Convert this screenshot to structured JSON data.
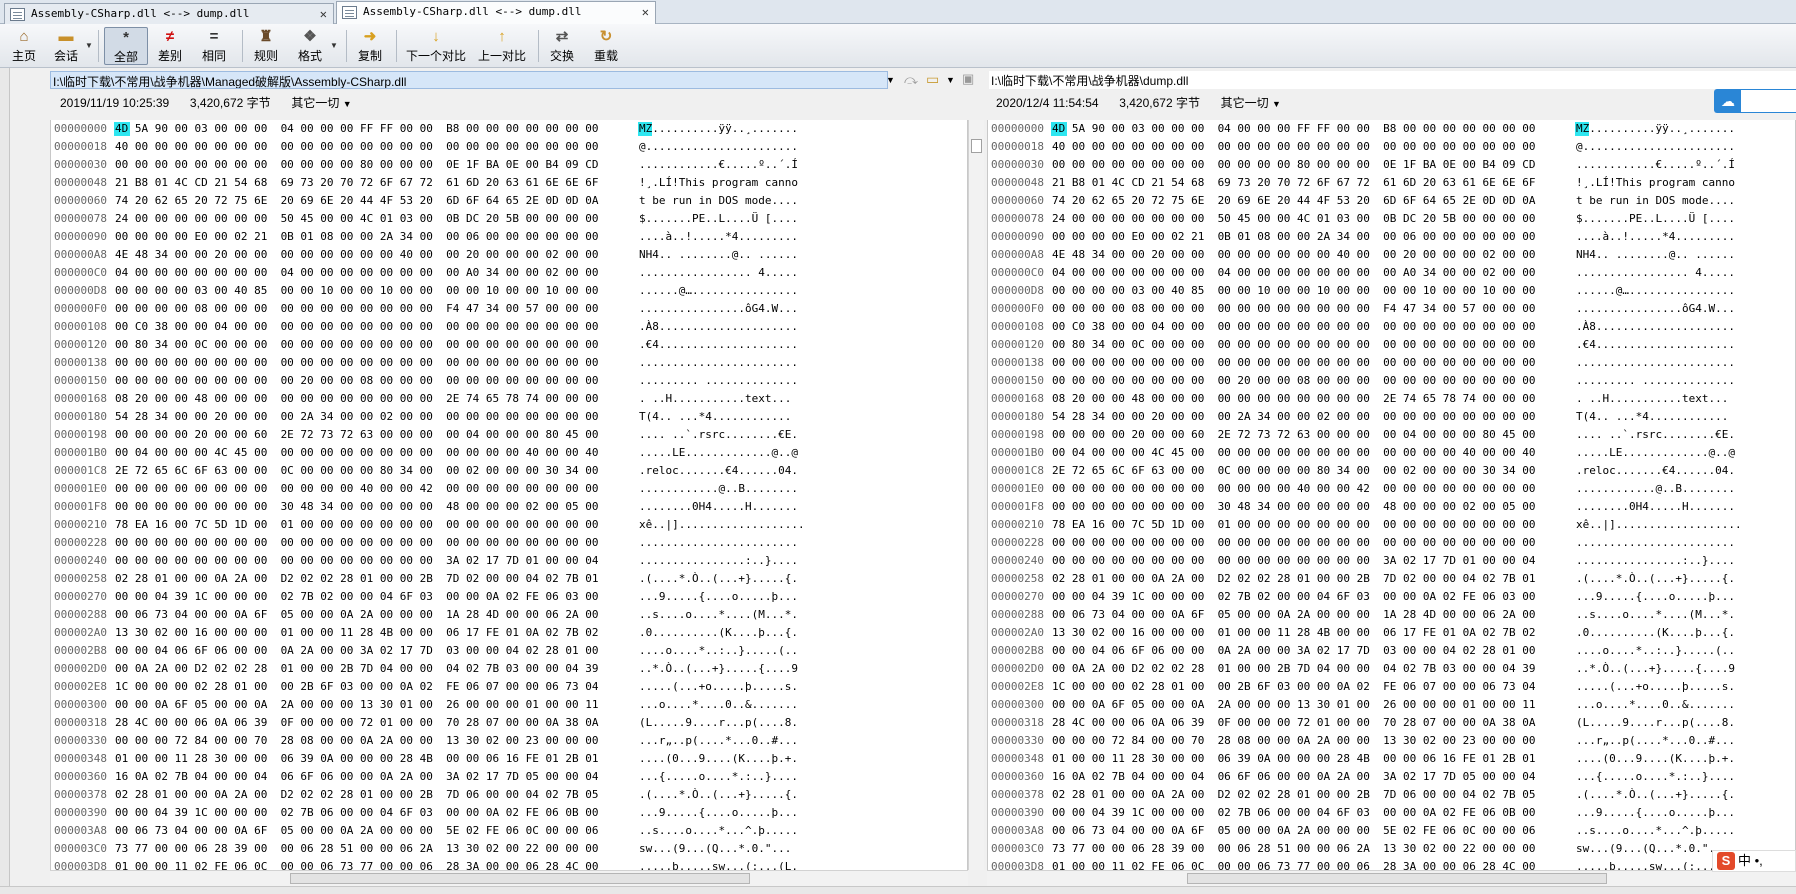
{
  "tabs": [
    {
      "label": "Assembly-CSharp.dll <--> dump.dll",
      "active": false
    },
    {
      "label": "Assembly-CSharp.dll <--> dump.dll",
      "active": true
    }
  ],
  "toolbar": {
    "home": "主页",
    "session": "会话",
    "all": "全部",
    "diffs": "差别",
    "same": "相同",
    "rules": "规则",
    "format": "格式",
    "copy": "复制",
    "next": "下一个对比",
    "prev": "上一对比",
    "swap": "交换",
    "reload": "重载"
  },
  "left": {
    "path": "I:\\临时下载\\不常用\\战争机器\\Managed破解版\\Assembly-CSharp.dll",
    "date": "2019/11/19 10:25:39",
    "size": "3,420,672 字节",
    "encoding": "其它一切"
  },
  "right": {
    "path": "I:\\临时下载\\不常用\\战争机器\\dump.dll",
    "date": "2020/12/4 11:54:54",
    "size": "3,420,672 字节",
    "encoding": "其它一切"
  },
  "rows": [
    {
      "addr": "00000000",
      "hex": "4D 5A 90 00 03 00 00 00  04 00 00 00 FF FF 00 00  B8 00 00 00 00 00 00 00",
      "ascii": "MZ..........ÿÿ..¸......."
    },
    {
      "addr": "00000018",
      "hex": "40 00 00 00 00 00 00 00  00 00 00 00 00 00 00 00  00 00 00 00 00 00 00 00",
      "ascii": "@......................."
    },
    {
      "addr": "00000030",
      "hex": "00 00 00 00 00 00 00 00  00 00 00 00 80 00 00 00  0E 1F BA 0E 00 B4 09 CD",
      "ascii": "............€.....º..´.Í"
    },
    {
      "addr": "00000048",
      "hex": "21 B8 01 4C CD 21 54 68  69 73 20 70 72 6F 67 72  61 6D 20 63 61 6E 6E 6F",
      "ascii": "!¸.LÍ!This program canno"
    },
    {
      "addr": "00000060",
      "hex": "74 20 62 65 20 72 75 6E  20 69 6E 20 44 4F 53 20  6D 6F 64 65 2E 0D 0D 0A",
      "ascii": "t be run in DOS mode...."
    },
    {
      "addr": "00000078",
      "hex": "24 00 00 00 00 00 00 00  50 45 00 00 4C 01 03 00  0B DC 20 5B 00 00 00 00",
      "ascii": "$.......PE..L....Ü [...."
    },
    {
      "addr": "00000090",
      "hex": "00 00 00 00 E0 00 02 21  0B 01 08 00 00 2A 34 00  00 06 00 00 00 00 00 00",
      "ascii": "....à..!.....*4........."
    },
    {
      "addr": "000000A8",
      "hex": "4E 48 34 00 00 20 00 00  00 00 00 00 00 00 40 00  00 20 00 00 00 02 00 00",
      "ascii": "NH4.. ........@.. ......"
    },
    {
      "addr": "000000C0",
      "hex": "04 00 00 00 00 00 00 00  04 00 00 00 00 00 00 00  00 A0 34 00 00 02 00 00",
      "ascii": "................. 4....."
    },
    {
      "addr": "000000D8",
      "hex": "00 00 00 00 03 00 40 85  00 00 10 00 00 10 00 00  00 00 10 00 00 10 00 00",
      "ascii": "......@…................"
    },
    {
      "addr": "000000F0",
      "hex": "00 00 00 00 08 00 00 00  00 00 00 00 00 00 00 00  F4 47 34 00 57 00 00 00",
      "ascii": "................ôG4.W..."
    },
    {
      "addr": "00000108",
      "hex": "00 C0 38 00 00 04 00 00  00 00 00 00 00 00 00 00  00 00 00 00 00 00 00 00",
      "ascii": ".À8....................."
    },
    {
      "addr": "00000120",
      "hex": "00 80 34 00 0C 00 00 00  00 00 00 00 00 00 00 00  00 00 00 00 00 00 00 00",
      "ascii": ".€4....................."
    },
    {
      "addr": "00000138",
      "hex": "00 00 00 00 00 00 00 00  00 00 00 00 00 00 00 00  00 00 00 00 00 00 00 00",
      "ascii": "........................"
    },
    {
      "addr": "00000150",
      "hex": "00 00 00 00 00 00 00 00  00 20 00 00 08 00 00 00  00 00 00 00 00 00 00 00",
      "ascii": "......... .............."
    },
    {
      "addr": "00000168",
      "hex": "08 20 00 00 48 00 00 00  00 00 00 00 00 00 00 00  2E 74 65 78 74 00 00 00",
      "ascii": ". ..H...........text..."
    },
    {
      "addr": "00000180",
      "hex": "54 28 34 00 00 20 00 00  00 2A 34 00 00 02 00 00  00 00 00 00 00 00 00 00",
      "ascii": "T(4.. ...*4............"
    },
    {
      "addr": "00000198",
      "hex": "00 00 00 00 20 00 00 60  2E 72 73 72 63 00 00 00  00 04 00 00 00 80 45 00",
      "ascii": ".... ..`.rsrc........€E."
    },
    {
      "addr": "000001B0",
      "hex": "00 04 00 00 00 4C 45 00  00 00 00 00 00 00 00 00  00 00 00 00 40 00 00 40",
      "ascii": ".....LE.............@..@"
    },
    {
      "addr": "000001C8",
      "hex": "2E 72 65 6C 6F 63 00 00  0C 00 00 00 00 80 34 00  00 02 00 00 00 30 34 00",
      "ascii": ".reloc.......€4......04."
    },
    {
      "addr": "000001E0",
      "hex": "00 00 00 00 00 00 00 00  00 00 00 00 40 00 00 42  00 00 00 00 00 00 00 00",
      "ascii": "............@..B........"
    },
    {
      "addr": "000001F8",
      "hex": "00 00 00 00 00 00 00 00  30 48 34 00 00 00 00 00  48 00 00 00 02 00 05 00",
      "ascii": "........0H4.....H......."
    },
    {
      "addr": "00000210",
      "hex": "78 EA 16 00 7C 5D 1D 00  01 00 00 00 00 00 00 00  00 00 00 00 00 00 00 00",
      "ascii": "xê..|]..................."
    },
    {
      "addr": "00000228",
      "hex": "00 00 00 00 00 00 00 00  00 00 00 00 00 00 00 00  00 00 00 00 00 00 00 00",
      "ascii": "........................"
    },
    {
      "addr": "00000240",
      "hex": "00 00 00 00 00 00 00 00  00 00 00 00 00 00 00 00  3A 02 17 7D 01 00 00 04",
      "ascii": "................:..}...."
    },
    {
      "addr": "00000258",
      "hex": "02 28 01 00 00 0A 2A 00  D2 02 02 28 01 00 00 2B  7D 02 00 00 04 02 7B 01",
      "ascii": ".(....*.Ò..(...+}.....{."
    },
    {
      "addr": "00000270",
      "hex": "00 00 04 39 1C 00 00 00  02 7B 02 00 00 04 6F 03  00 00 0A 02 FE 06 03 00",
      "ascii": "...9.....{....o.....þ..."
    },
    {
      "addr": "00000288",
      "hex": "00 06 73 04 00 00 0A 6F  05 00 00 0A 2A 00 00 00  1A 28 4D 00 00 06 2A 00",
      "ascii": "..s....o....*....(M...*."
    },
    {
      "addr": "000002A0",
      "hex": "13 30 02 00 16 00 00 00  01 00 00 11 28 4B 00 00  06 17 FE 01 0A 02 7B 02",
      "ascii": ".0..........(K....þ...{."
    },
    {
      "addr": "000002B8",
      "hex": "00 00 04 06 6F 06 00 00  0A 2A 00 00 3A 02 17 7D  03 00 00 04 02 28 01 00",
      "ascii": "....o....*..:..}.....(.."
    },
    {
      "addr": "000002D0",
      "hex": "00 0A 2A 00 D2 02 02 28  01 00 00 2B 7D 04 00 00  04 02 7B 03 00 00 04 39",
      "ascii": "..*.Ò..(...+}.....{....9"
    },
    {
      "addr": "000002E8",
      "hex": "1C 00 00 00 02 28 01 00  00 2B 6F 03 00 00 0A 02  FE 06 07 00 00 06 73 04",
      "ascii": ".....(...+o.....þ.....s."
    },
    {
      "addr": "00000300",
      "hex": "00 00 0A 6F 05 00 00 0A  2A 00 00 00 13 30 01 00  26 00 00 00 01 00 00 11",
      "ascii": "...o....*....0..&......."
    },
    {
      "addr": "00000318",
      "hex": "28 4C 00 00 06 0A 06 39  0F 00 00 00 72 01 00 00  70 28 07 00 00 0A 38 0A",
      "ascii": "(L.....9....r...p(....8."
    },
    {
      "addr": "00000330",
      "hex": "00 00 00 72 84 00 00 70  28 08 00 00 0A 2A 00 00  13 30 02 00 23 00 00 00",
      "ascii": "...r„..p(....*...0..#..."
    },
    {
      "addr": "00000348",
      "hex": "01 00 00 11 28 30 00 00  06 39 0A 00 00 00 28 4B  00 00 06 16 FE 01 2B 01",
      "ascii": "....(0...9....(K....þ.+."
    },
    {
      "addr": "00000360",
      "hex": "16 0A 02 7B 04 00 00 04  06 6F 06 00 00 0A 2A 00  3A 02 17 7D 05 00 00 04",
      "ascii": "...{.....o....*.:..}...."
    },
    {
      "addr": "00000378",
      "hex": "02 28 01 00 00 0A 2A 00  D2 02 02 28 01 00 00 2B  7D 06 00 00 04 02 7B 05",
      "ascii": ".(....*.Ò..(...+}.....{."
    },
    {
      "addr": "00000390",
      "hex": "00 00 04 39 1C 00 00 00  02 7B 06 00 00 04 6F 03  00 00 0A 02 FE 06 0B 00",
      "ascii": "...9.....{....o.....þ..."
    },
    {
      "addr": "000003A8",
      "hex": "00 06 73 04 00 00 0A 6F  05 00 00 0A 2A 00 00 00  5E 02 FE 06 0C 00 00 06",
      "ascii": "..s....o....*...^.þ....."
    },
    {
      "addr": "000003C0",
      "hex": "73 77 00 00 06 28 39 00  00 06 28 51 00 00 06 2A  13 30 02 00 22 00 00 00",
      "ascii": "sw...(9...(Q...*.0.\"..."
    },
    {
      "addr": "000003D8",
      "hex": "01 00 00 11 02 FE 06 0C  00 00 06 73 77 00 00 06  28 3A 00 00 06 28 4C 00",
      "ascii": ".....þ.....sw...(:...(L."
    }
  ]
}
